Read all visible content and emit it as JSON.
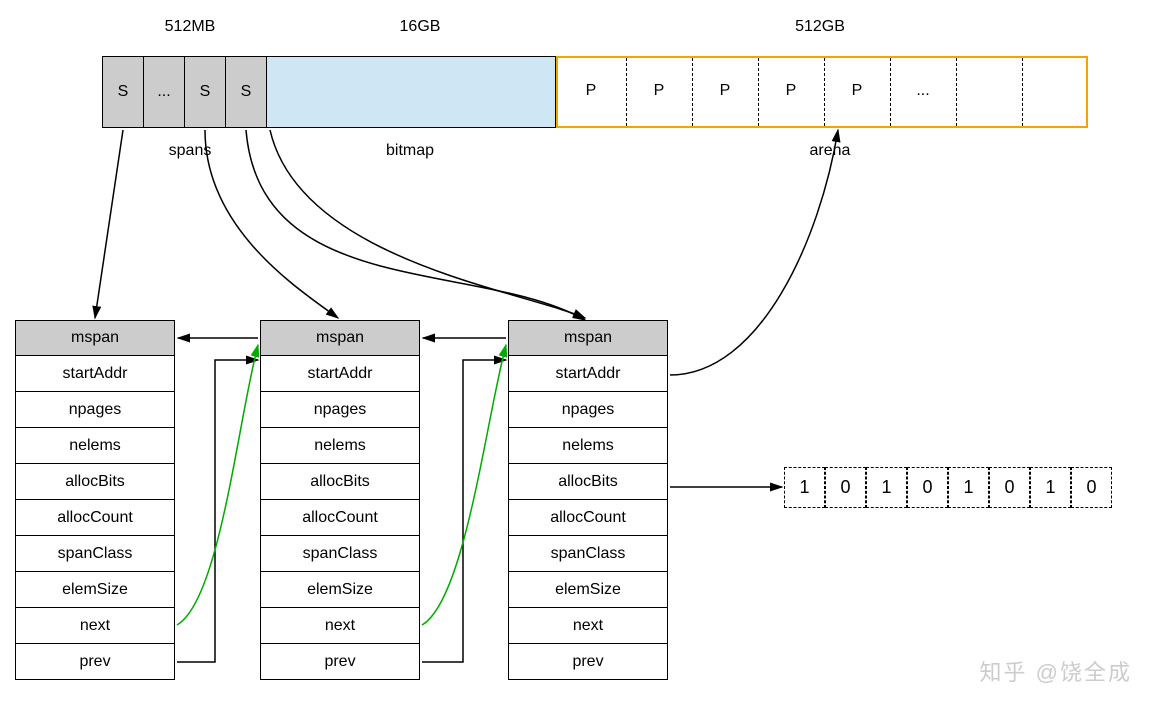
{
  "sizes": {
    "spans": "512MB",
    "bitmap": "16GB",
    "arena": "512GB"
  },
  "sections": {
    "spans": "spans",
    "bitmap": "bitmap",
    "arena": "arena"
  },
  "cells": {
    "s": "S",
    "dots": "...",
    "p": "P"
  },
  "mspan": {
    "header": "mspan",
    "fields": [
      "startAddr",
      "npages",
      "nelems",
      "allocBits",
      "allocCount",
      "spanClass",
      "elemSize",
      "next",
      "prev"
    ]
  },
  "allocBits": [
    "1",
    "0",
    "1",
    "0",
    "1",
    "0",
    "1",
    "0"
  ],
  "watermark": "知乎 @饶全成"
}
